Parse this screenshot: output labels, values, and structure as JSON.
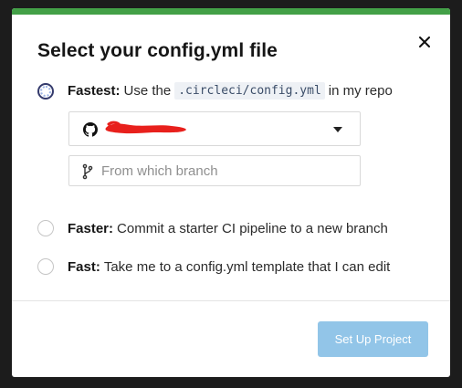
{
  "modal": {
    "title": "Select your config.yml file",
    "accent_color": "#43a047"
  },
  "options": [
    {
      "strong": "Fastest:",
      "text_before": "Use the",
      "code": ".circleci/config.yml",
      "text_after": "in my repo",
      "selected": true
    },
    {
      "strong": "Faster:",
      "text": "Commit a starter CI pipeline to a new branch",
      "selected": false
    },
    {
      "strong": "Fast:",
      "text": "Take me to a config.yml template that I can edit",
      "selected": false
    }
  ],
  "repo_select": {
    "icon": "github-icon",
    "value_redacted": true
  },
  "branch_input": {
    "icon": "git-branch-icon",
    "placeholder": "From which branch",
    "value": ""
  },
  "footer": {
    "setup_button": "Set Up Project",
    "setup_button_color": "#92c5e8"
  }
}
